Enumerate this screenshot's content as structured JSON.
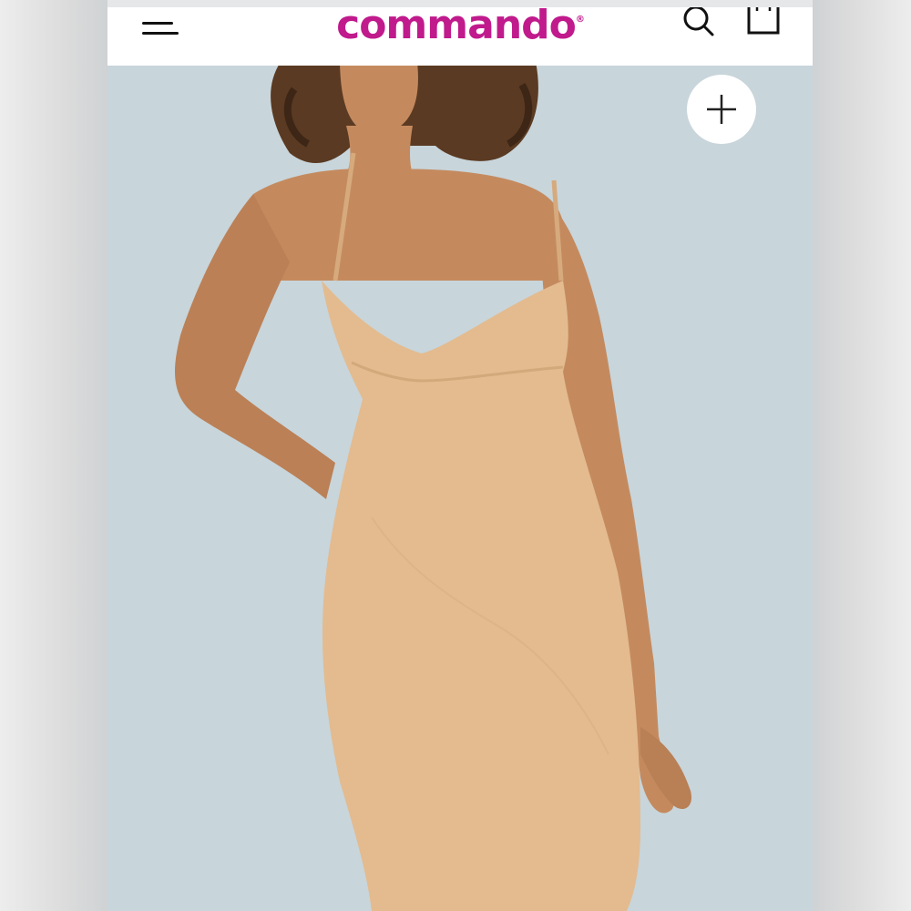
{
  "header": {
    "logo_text": "commando",
    "logo_mark": "®",
    "brand_color": "#c01a8c",
    "icons": {
      "menu": "hamburger-menu-icon",
      "search": "search-icon",
      "bag": "shopping-bag-icon",
      "expand": "plus-icon"
    }
  },
  "product_image": {
    "background_color": "#c9d6dc",
    "garment_color": "#e2b98c",
    "skin_color": "#c48a5e"
  }
}
